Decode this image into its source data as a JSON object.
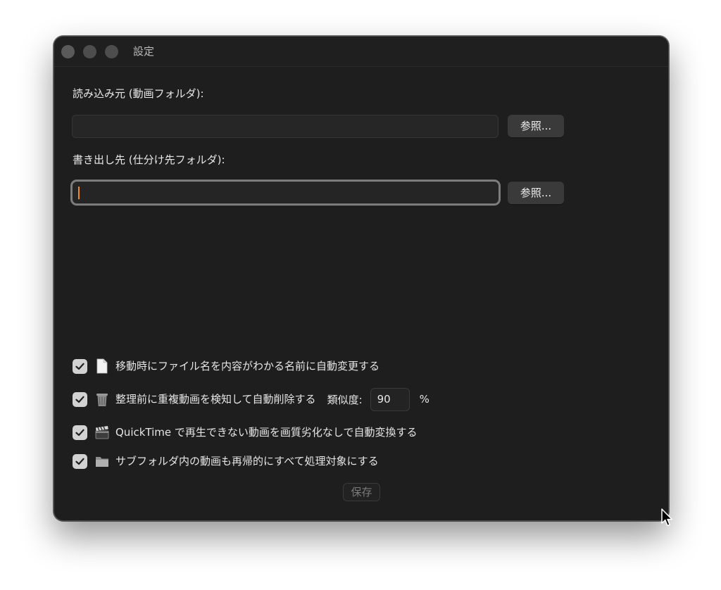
{
  "window": {
    "title": "設定"
  },
  "source": {
    "label": "読み込み元 (動画フォルダ):",
    "value": "",
    "browse_label": "参照..."
  },
  "destination": {
    "label": "書き出し先 (仕分け先フォルダ):",
    "value": "",
    "browse_label": "参照..."
  },
  "options": [
    {
      "label": "移動時にファイル名を内容がわかる名前に自動変更する",
      "checked": true,
      "icon": "document-icon"
    },
    {
      "label": "整理前に重複動画を検知して自動削除する",
      "checked": true,
      "icon": "trash-icon"
    },
    {
      "label": "QuickTime で再生できない動画を画質劣化なしで自動変換する",
      "checked": true,
      "icon": "clapperboard-icon"
    },
    {
      "label": "サブフォルダ内の動画も再帰的にすべて処理対象にする",
      "checked": true,
      "icon": "folder-icon"
    }
  ],
  "similarity": {
    "label": "類似度:",
    "value": "90",
    "unit": "%"
  },
  "save_label": "保存",
  "colors": {
    "window_bg": "#1e1e1e",
    "caret": "#f08a24",
    "checkbox": "#d2d2d2"
  }
}
